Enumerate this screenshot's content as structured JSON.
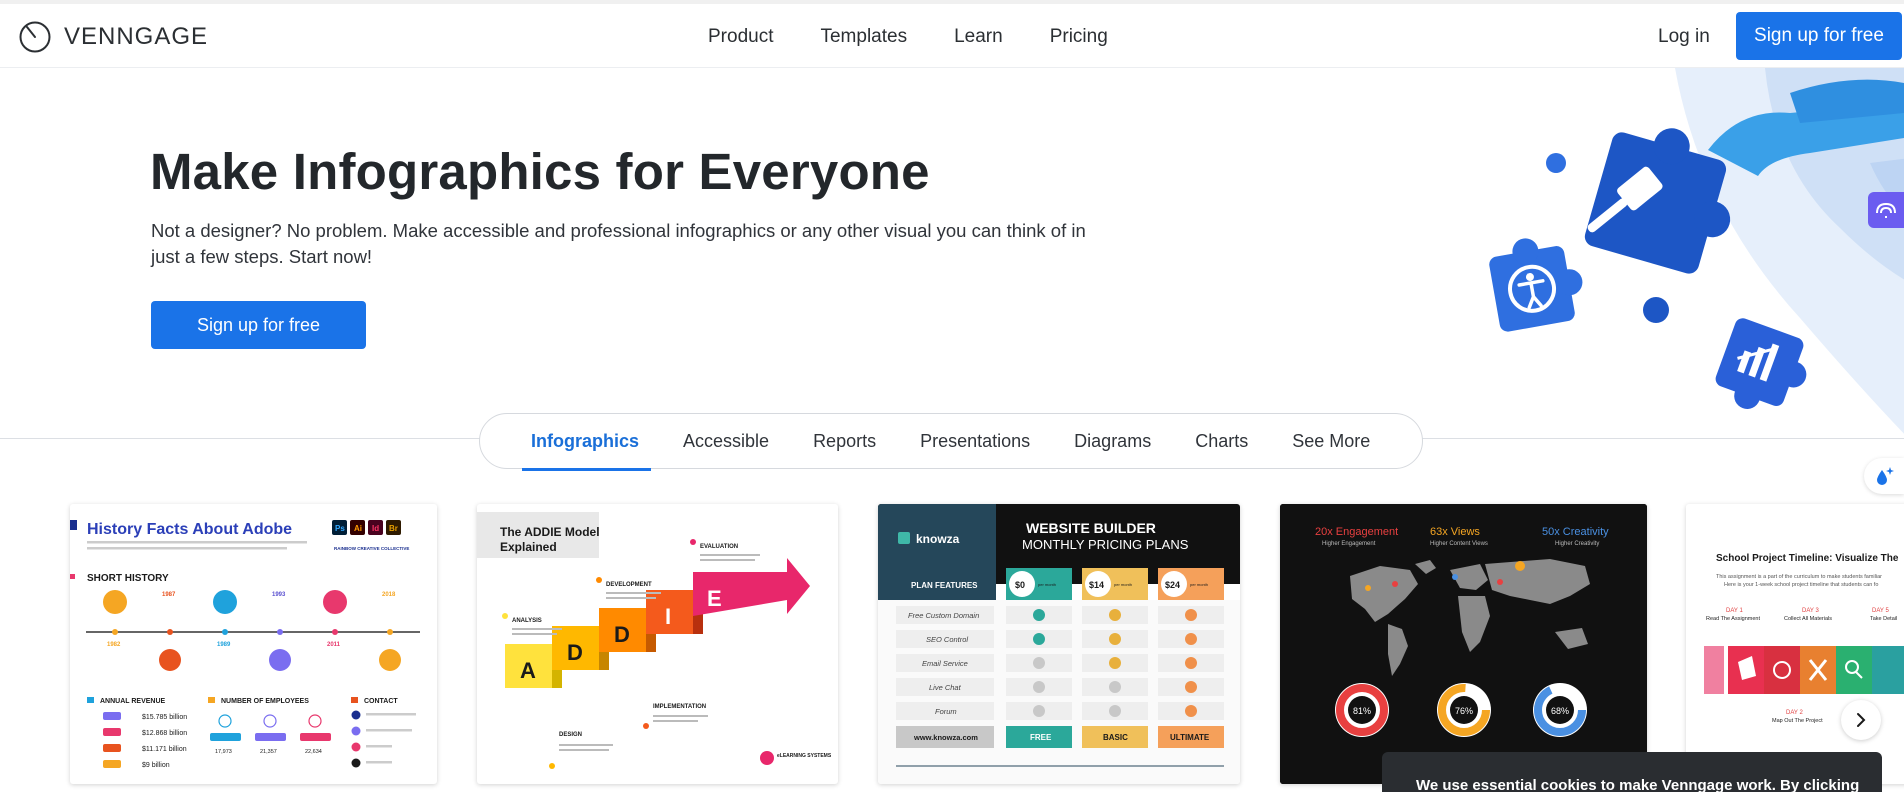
{
  "brand": {
    "name": "VENNGAGE"
  },
  "nav": {
    "items": [
      "Product",
      "Templates",
      "Learn",
      "Pricing"
    ],
    "login": "Log in",
    "signup": "Sign up for free"
  },
  "hero": {
    "title": "Make Infographics for Everyone",
    "subtitle": "Not a designer? No problem. Make accessible and professional infographics or any other visual you can think of in just a few steps. Start now!",
    "cta": "Sign up for free"
  },
  "tabs": [
    "Infographics",
    "Accessible",
    "Reports",
    "Presentations",
    "Diagrams",
    "Charts",
    "See More"
  ],
  "cards": {
    "adobe": {
      "title": "History Facts About Adobe",
      "badges": [
        "Ps",
        "Ai",
        "Id",
        "Br"
      ],
      "collective": "RAINBOW CREATIVE COLLECTIVE",
      "short_history": "SHORT HISTORY",
      "years_top": [
        "1987",
        "1993",
        "2018"
      ],
      "years_bottom": [
        "1982",
        "1989",
        "2011"
      ],
      "annual_revenue": "ANNUAL REVENUE",
      "revenues": [
        "$15.785 billion",
        "$12.868 billion",
        "$11.171 billion",
        "$9 billion"
      ],
      "employees": "NUMBER OF EMPLOYEES",
      "employee_counts": [
        "17,973",
        "21,357",
        "22,634"
      ],
      "contact": "CONTACT"
    },
    "addie": {
      "title": "The ADDIE Model Explained",
      "letters": [
        "A",
        "D",
        "D",
        "I",
        "E"
      ],
      "stages": [
        "ANALYSIS",
        "DESIGN",
        "DEVELOPMENT",
        "IMPLEMENTATION",
        "EVALUATION"
      ],
      "footer": "eLEARNING SYSTEMS"
    },
    "pricing": {
      "brand": "knowza",
      "title1": "WEBSITE BUILDER",
      "title2": "MONTHLY PRICING PLANS",
      "features_header": "PLAN FEATURES",
      "prices": [
        "$0",
        "$14",
        "$24"
      ],
      "per_month": "per month",
      "features": [
        "Free Custom Domain",
        "SEO Control",
        "Email Service",
        "Live Chat",
        "Forum"
      ],
      "url": "www.knowza.com",
      "plans": [
        "FREE",
        "BASIC",
        "ULTIMATE"
      ]
    },
    "map": {
      "metrics": [
        {
          "value": "20x Engagement",
          "label": "Higher Engagement",
          "color": "#e84040"
        },
        {
          "value": "63x Views",
          "label": "Higher Content Views",
          "color": "#f5a623"
        },
        {
          "value": "50x Creativity",
          "label": "Higher Creativity",
          "color": "#4a90e2"
        }
      ],
      "donuts": [
        {
          "label": "81%",
          "pct": 0.81,
          "color": "#e84040"
        },
        {
          "label": "76%",
          "pct": 0.76,
          "color": "#f5a623"
        },
        {
          "label": "68%",
          "pct": 0.68,
          "color": "#4a90e2"
        }
      ]
    },
    "timeline": {
      "title": "School Project Timeline: Visualize The",
      "desc1": "This assignment is a part of the curriculum to make students familiar",
      "desc2": "Here is your 1-week school project timeline that students can fo",
      "days": [
        "DAY 1",
        "DAY 3",
        "DAY 5"
      ],
      "tasks": [
        "Read The Assignment",
        "Collect All Materials",
        "Take Detail"
      ],
      "day2": "DAY 2",
      "task2": "Map Out The Project"
    }
  },
  "cookie": {
    "text": "We use essential cookies to make Venngage work. By clicking"
  },
  "icons": {
    "logo": "venngage-clock-logo-icon",
    "side_tab": "accessibility-brain-icon",
    "side_fab": "sparkle-drop-icon",
    "next": "chevron-right-icon"
  },
  "colors": {
    "accent": "#1a73e8",
    "dark": "#23272b"
  }
}
